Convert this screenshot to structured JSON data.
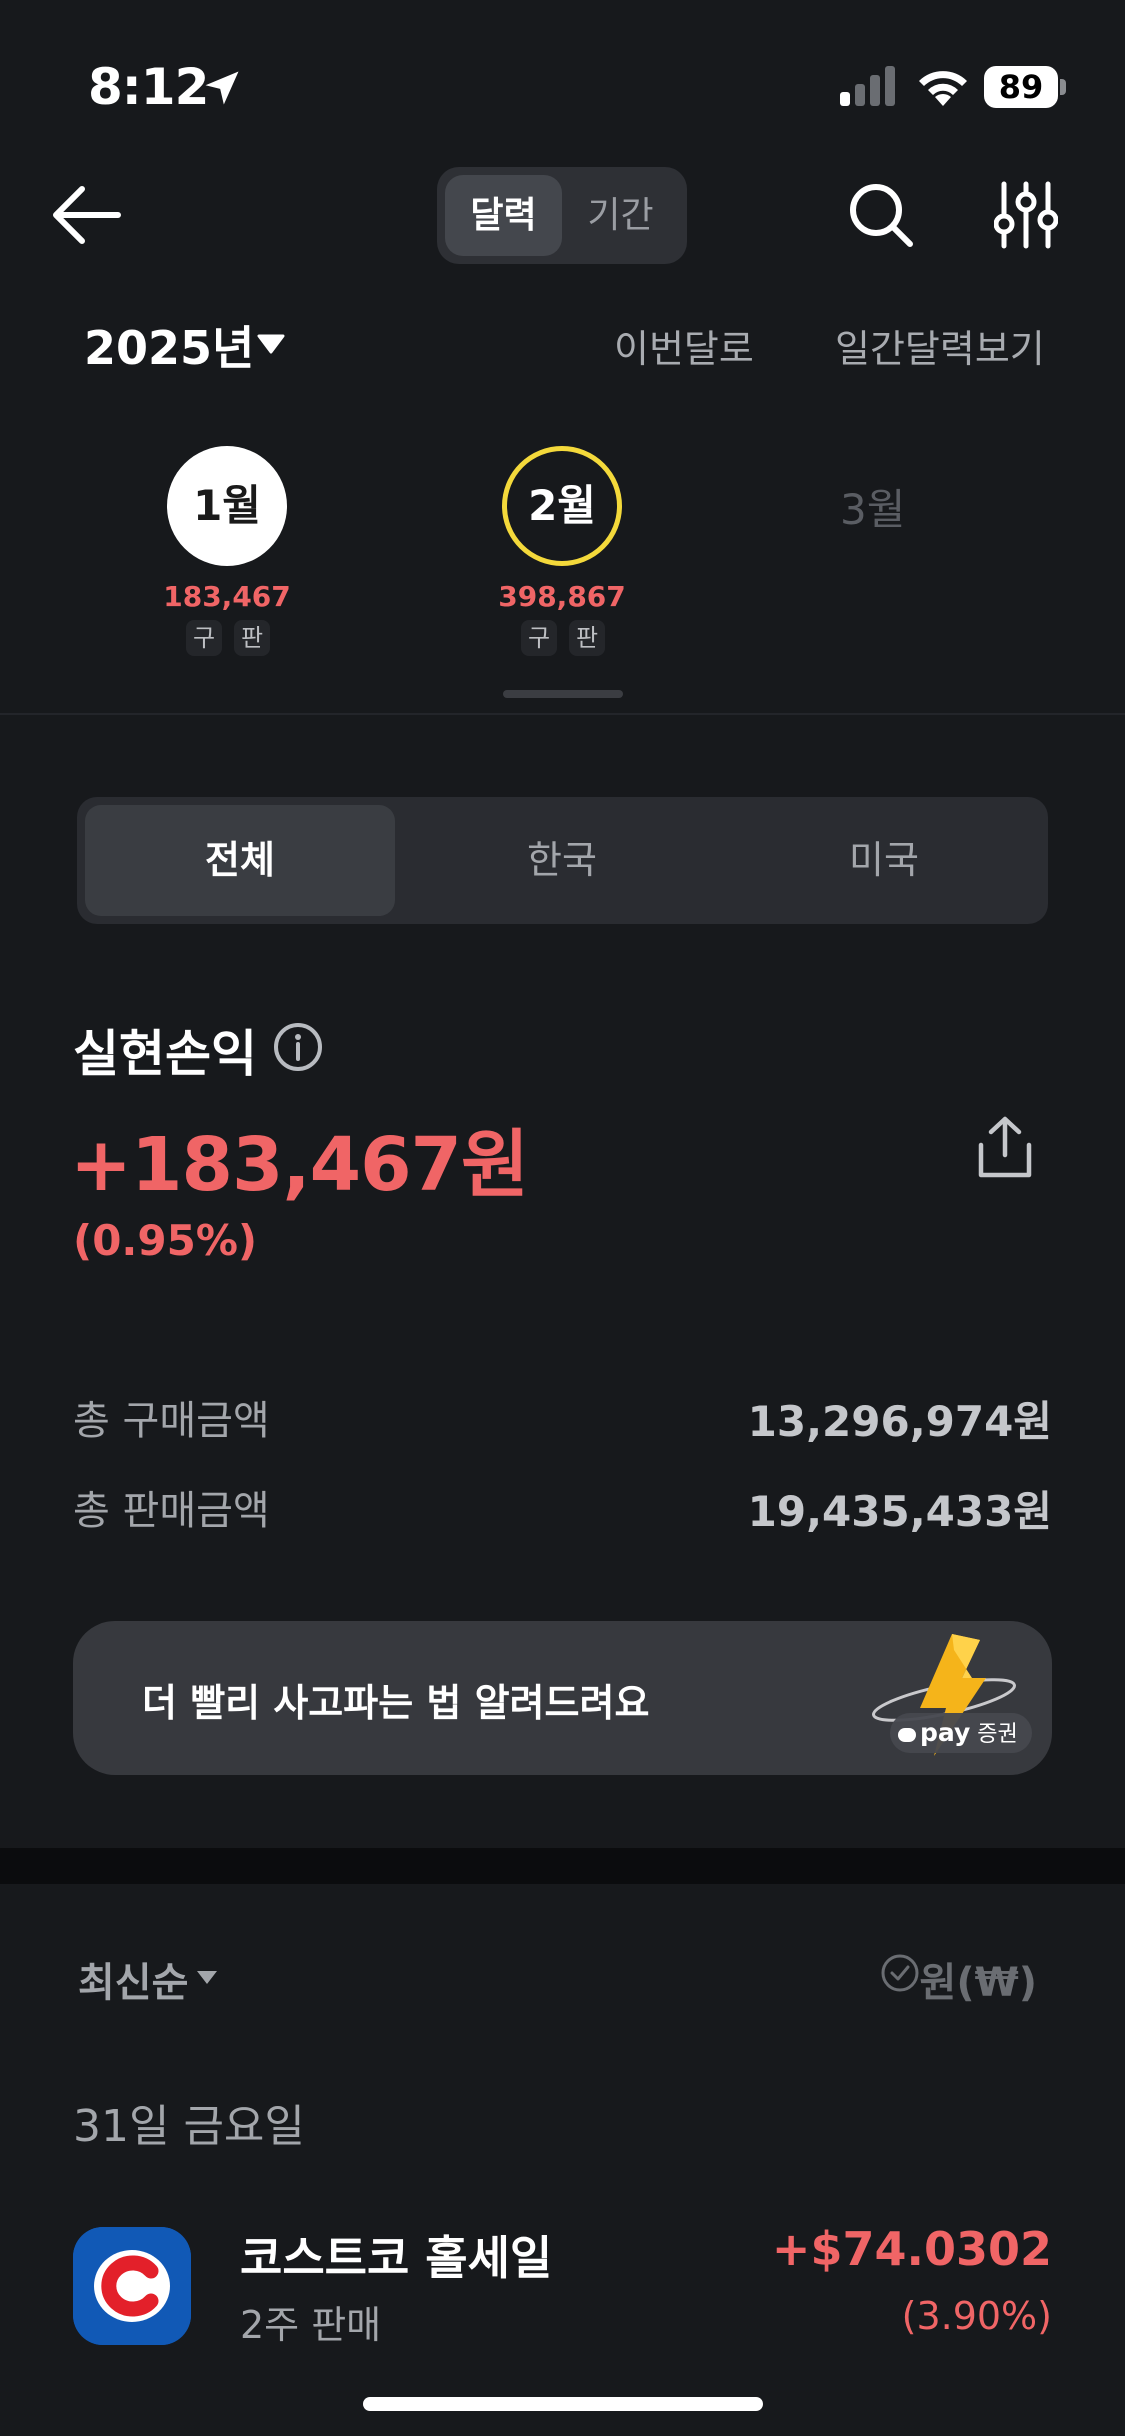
{
  "status_bar": {
    "time": "8:12",
    "battery": "89"
  },
  "nav": {
    "tabs": [
      {
        "label": "달력"
      },
      {
        "label": "기간"
      }
    ]
  },
  "calendar": {
    "year": "2025년",
    "this_month_link": "이번달로",
    "daily_calendar_link": "일간달력보기",
    "months": [
      {
        "label": "1월",
        "amount": "183,467",
        "tags": [
          "구",
          "판"
        ]
      },
      {
        "label": "2월",
        "amount": "398,867",
        "tags": [
          "구",
          "판"
        ]
      },
      {
        "label": "3월"
      }
    ]
  },
  "market_filter": {
    "options": [
      "전체",
      "한국",
      "미국"
    ],
    "selected": "전체"
  },
  "summary": {
    "title": "실현손익",
    "amount": "+183,467원",
    "percent": "(0.95%)",
    "total_buy_label": "총 구매금액",
    "total_buy_value": "13,296,974원",
    "total_sell_label": "총 판매금액",
    "total_sell_value": "19,435,433원"
  },
  "banner": {
    "text": "더 빨리 사고파는 법 알려드려요",
    "brand": "pay",
    "brand_suffix": "증권"
  },
  "list": {
    "sort_label": "최신순",
    "currency_label": "원(₩)",
    "date_header": "31일 금요일",
    "items": [
      {
        "name": "코스트코 홀세일",
        "sub": "2주 판매",
        "amount": "+$74.0302",
        "percent": "(3.90%)"
      }
    ]
  },
  "colors": {
    "background": "#17191c",
    "profit_red": "#f06566",
    "highlight_yellow": "#f4d93b",
    "costco_blue": "#1159b6",
    "costco_red": "#e3202a"
  }
}
